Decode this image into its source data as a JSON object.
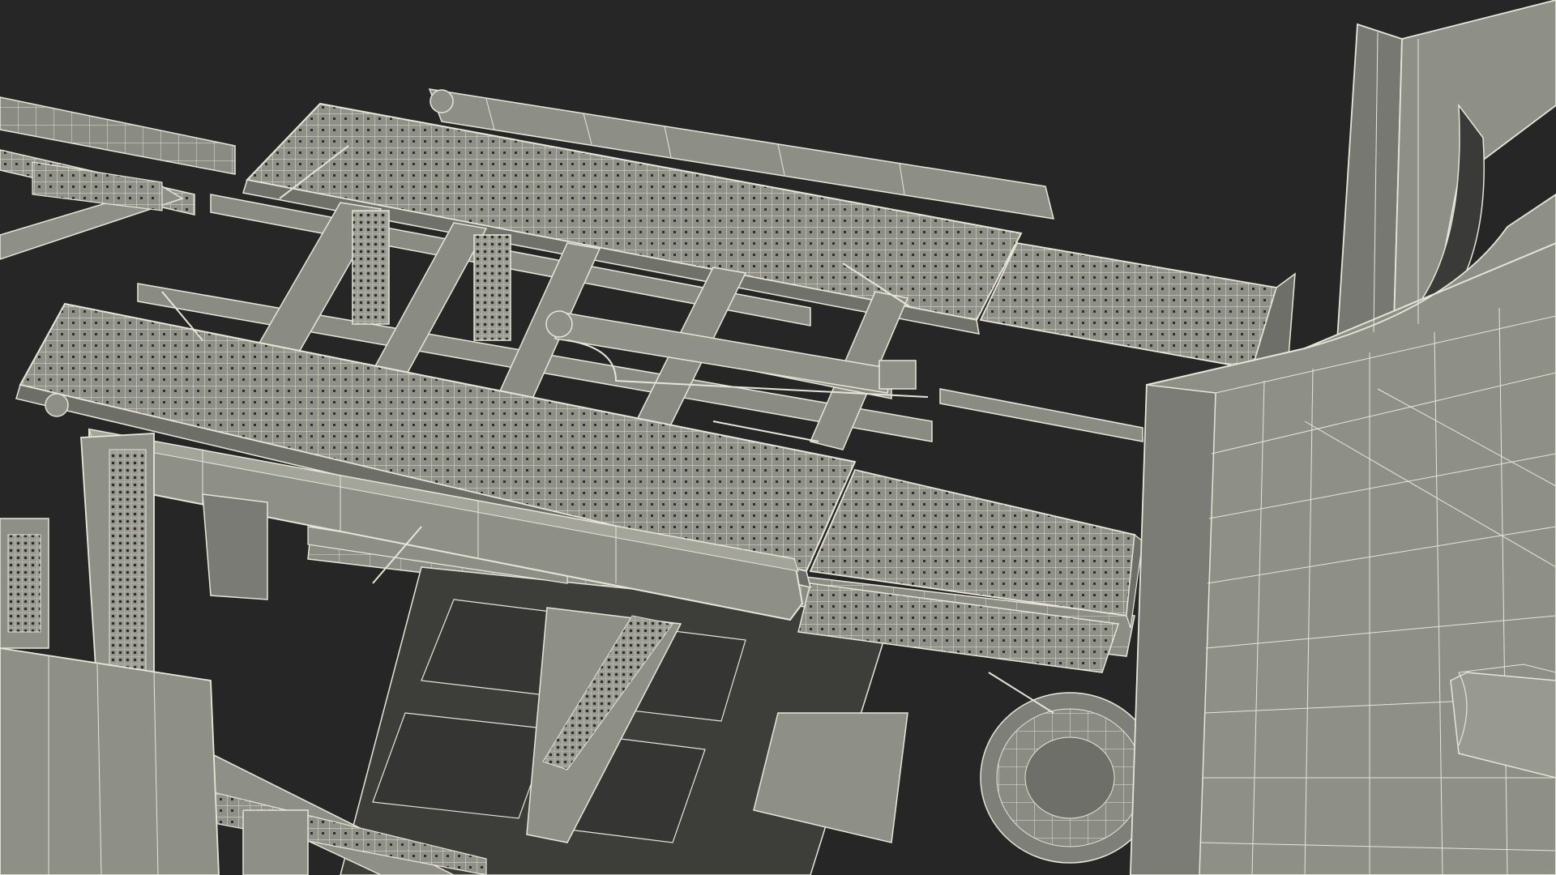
{
  "scene": {
    "subject": "wireframe-car-transporter-trailer-render",
    "colors": {
      "background": "#262626",
      "surface": "#8e8f86",
      "surface_light": "#a3a49a",
      "surface_dark": "#6f706a",
      "wire": "#e6e6d8",
      "shadow": "#4a4b46",
      "void": "#3a3b38"
    }
  }
}
